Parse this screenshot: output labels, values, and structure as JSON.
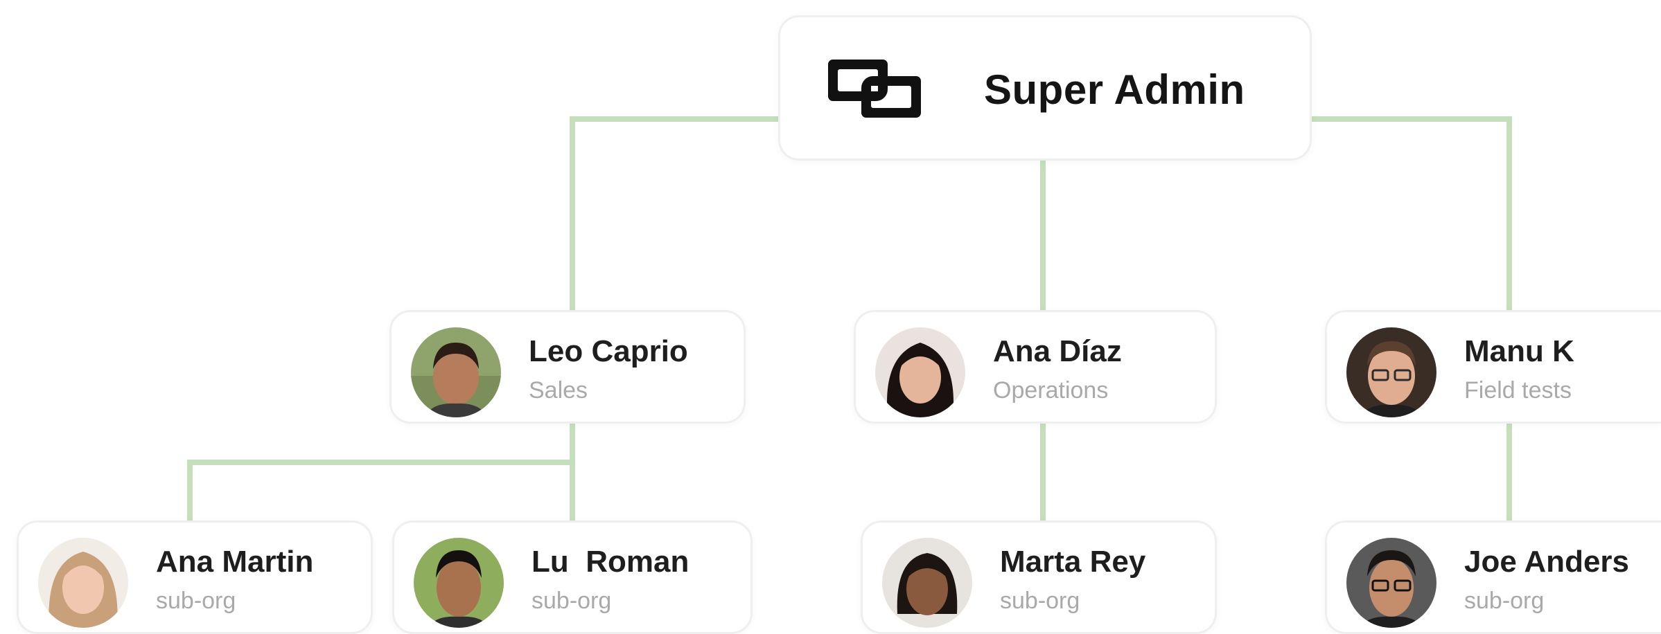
{
  "root": {
    "title": "Super Admin",
    "icon": "linked-squares-logo-icon"
  },
  "colors": {
    "connector": "#c5dfbd",
    "name": "#1e1e1e",
    "subtitle": "#a9a9a9"
  },
  "people": {
    "leo": {
      "name": "Leo Caprio",
      "role": "Sales"
    },
    "ana_diaz": {
      "name": "Ana Díaz",
      "role": "Operations"
    },
    "manu": {
      "name": "Manu K",
      "role": "Field tests"
    },
    "ana_martin": {
      "name": "Ana Martin",
      "role": "sub-org"
    },
    "lu_roman": {
      "name": "Lu  Roman",
      "role": "sub-org"
    },
    "marta": {
      "name": "Marta Rey",
      "role": "sub-org"
    },
    "joe": {
      "name": "Joe Anders",
      "role": "sub-org"
    }
  }
}
